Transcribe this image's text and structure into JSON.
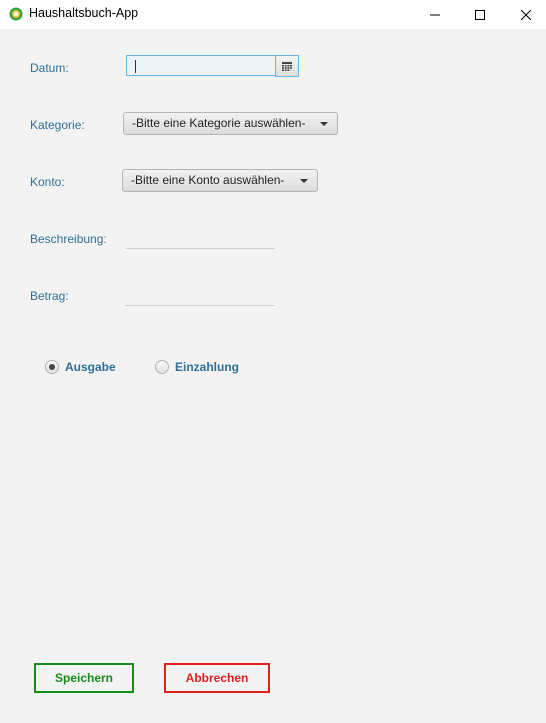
{
  "window": {
    "title": "Haushaltsbuch-App",
    "controls": [
      "minimize",
      "maximize",
      "close"
    ]
  },
  "form": {
    "datum_label": "Datum:",
    "datum_value": "",
    "kategorie_label": "Kategorie:",
    "kategorie_selected": "-Bitte eine Kategorie auswählen-",
    "konto_label": "Konto:",
    "konto_selected": "-Bitte eine Konto auswählen-",
    "beschreibung_label": "Beschreibung:",
    "beschreibung_value": "",
    "betrag_label": "Betrag:",
    "betrag_value": ""
  },
  "radio": {
    "ausgabe_label": "Ausgabe",
    "einzahlung_label": "Einzahlung",
    "selected": "Ausgabe"
  },
  "buttons": {
    "save_label": "Speichern",
    "cancel_label": "Abbrechen"
  },
  "colors": {
    "label": "#2f6f9a",
    "save": "#1a8a1a",
    "cancel": "#e02020",
    "focus": "#6bb7e3"
  }
}
